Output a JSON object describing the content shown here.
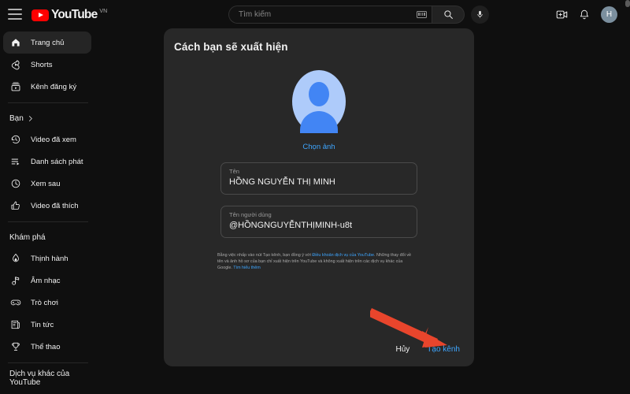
{
  "masthead": {
    "menu_icon": "hamburger-icon",
    "logo_text": "YouTube",
    "logo_superscript": "VN",
    "search": {
      "placeholder": "Tìm kiếm",
      "keyboard_icon": "keyboard-icon",
      "search_icon": "search-icon",
      "mic_icon": "microphone-icon"
    },
    "create_icon": "create-video-icon",
    "notifications_icon": "bell-icon",
    "avatar_initial": "H"
  },
  "sidebar": {
    "primary": [
      {
        "label": "Trang chủ",
        "icon": "home-icon",
        "active": true
      },
      {
        "label": "Shorts",
        "icon": "shorts-icon",
        "active": false
      },
      {
        "label": "Kênh đăng ký",
        "icon": "subscriptions-icon",
        "active": false
      }
    ],
    "you_section": {
      "label": "Bạn",
      "chevron": "chevron-right-icon"
    },
    "you_items": [
      {
        "label": "Video đã xem",
        "icon": "history-icon"
      },
      {
        "label": "Danh sách phát",
        "icon": "playlist-icon"
      },
      {
        "label": "Xem sau",
        "icon": "watch-later-icon"
      },
      {
        "label": "Video đã thích",
        "icon": "thumbs-up-icon"
      }
    ],
    "explore_section": {
      "label": "Khám phá"
    },
    "explore_items": [
      {
        "label": "Thịnh hành",
        "icon": "trending-flame-icon"
      },
      {
        "label": "Âm nhạc",
        "icon": "music-note-icon"
      },
      {
        "label": "Trò chơi",
        "icon": "gaming-controller-icon"
      },
      {
        "label": "Tin tức",
        "icon": "news-icon"
      },
      {
        "label": "Thể thao",
        "icon": "trophy-icon"
      }
    ],
    "more_section": {
      "label": "Dịch vụ khác của YouTube"
    }
  },
  "dialog": {
    "title": "Cách bạn sẽ xuất hiện",
    "avatar_icon": "default-person-avatar",
    "choose_photo_label": "Chọn ảnh",
    "name_field": {
      "label": "Tên",
      "value": "HỒNG NGUYỄN THỊ MINH"
    },
    "username_field": {
      "label": "Tên người dùng",
      "value": "@HỒNGNGUYỄNTHỊMINH-u8t"
    },
    "legal": {
      "part1": "Bằng việc nhấp vào nút Tạo kênh, bạn đồng ý với ",
      "link1": "Điều khoản dịch vụ của YouTube",
      "part2": ". Những thay đổi về tên và ảnh hồ sơ của bạn chỉ xuất hiện trên YouTube và không xuất hiện trên các dịch vụ khác của Google. ",
      "link2": "Tìm hiểu thêm"
    },
    "cancel_label": "Hủy",
    "create_label": "Tạo kênh"
  },
  "annotation": {
    "arrow_color": "#e8452c",
    "points_to": "Tạo kênh"
  },
  "colors": {
    "page_bg": "#0f0f0f",
    "dialog_bg": "#282828",
    "accent_blue": "#3ea6ff",
    "youtube_red": "#ff0000",
    "avatar_bg": "#aecbfa",
    "avatar_fg": "#4285f4"
  }
}
